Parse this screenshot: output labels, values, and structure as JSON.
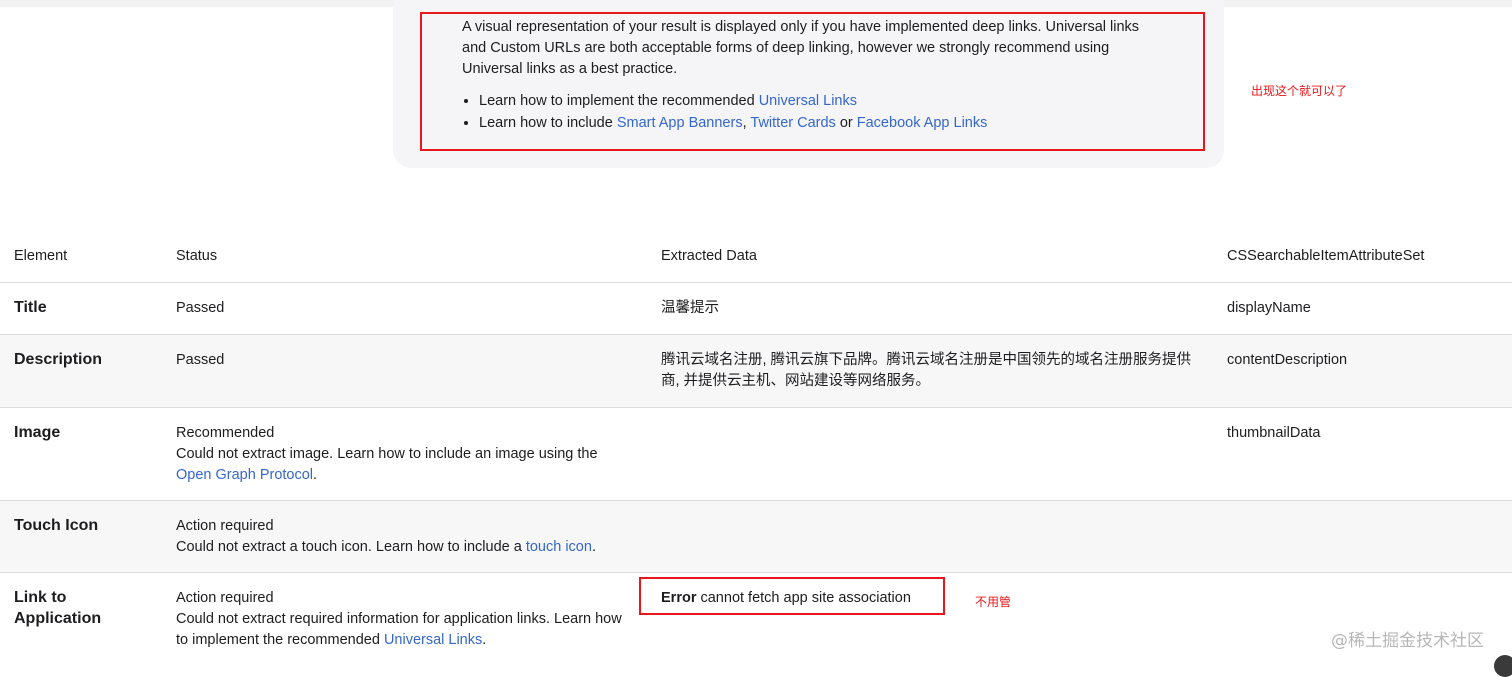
{
  "info": {
    "paragraph": "A visual representation of your result is displayed only if you have implemented deep links. Universal links and Custom URLs are both acceptable forms of deep linking, however we strongly recommend using Universal links as a best practice.",
    "bullet1": {
      "prefix": "Learn how to implement the recommended ",
      "link": "Universal Links"
    },
    "bullet2": {
      "prefix": "Learn how to include ",
      "link1": "Smart App Banners",
      "sep1": ", ",
      "link2": "Twitter Cards",
      "sep2": " or ",
      "link3": "Facebook App Links"
    }
  },
  "annotations": {
    "top_note": "出现这个就可以了",
    "error_note": "不用管"
  },
  "table": {
    "headers": {
      "element": "Element",
      "status": "Status",
      "extracted": "Extracted Data",
      "attribute": "CSSearchableItemAttributeSet"
    },
    "rows": [
      {
        "element": "Title",
        "status": "Passed",
        "extracted": "温馨提示",
        "attribute": "displayName"
      },
      {
        "element": "Description",
        "status": "Passed",
        "extracted": "腾讯云域名注册, 腾讯云旗下品牌。腾讯云域名注册是中国领先的域名注册服务提供商, 并提供云主机、网站建设等网络服务。",
        "attribute": "contentDescription"
      },
      {
        "element": "Image",
        "status": "Recommended",
        "detail_prefix": "Could not extract image. Learn how to include an image using the ",
        "detail_link": "Open Graph Protocol",
        "detail_suffix": ".",
        "attribute": "thumbnailData"
      },
      {
        "element": "Touch Icon",
        "status": "Action required",
        "detail_prefix": "Could not extract a touch icon. Learn how to include a ",
        "detail_link": "touch icon",
        "detail_suffix": "."
      },
      {
        "element": "Link to Application",
        "status": "Action required",
        "detail_prefix": "Could not extract required information for application links. Learn how to implement the recommended ",
        "detail_link": "Universal Links",
        "detail_suffix": ".",
        "error_label": "Error",
        "error_text": " cannot fetch app site association"
      }
    ]
  },
  "watermark": "@稀土掘金技术社区",
  "colors": {
    "link": "#3567c8",
    "annotation_red": "#e8171b",
    "card_bg": "#f5f5f7",
    "row_alt_bg": "#f7f7f8"
  }
}
